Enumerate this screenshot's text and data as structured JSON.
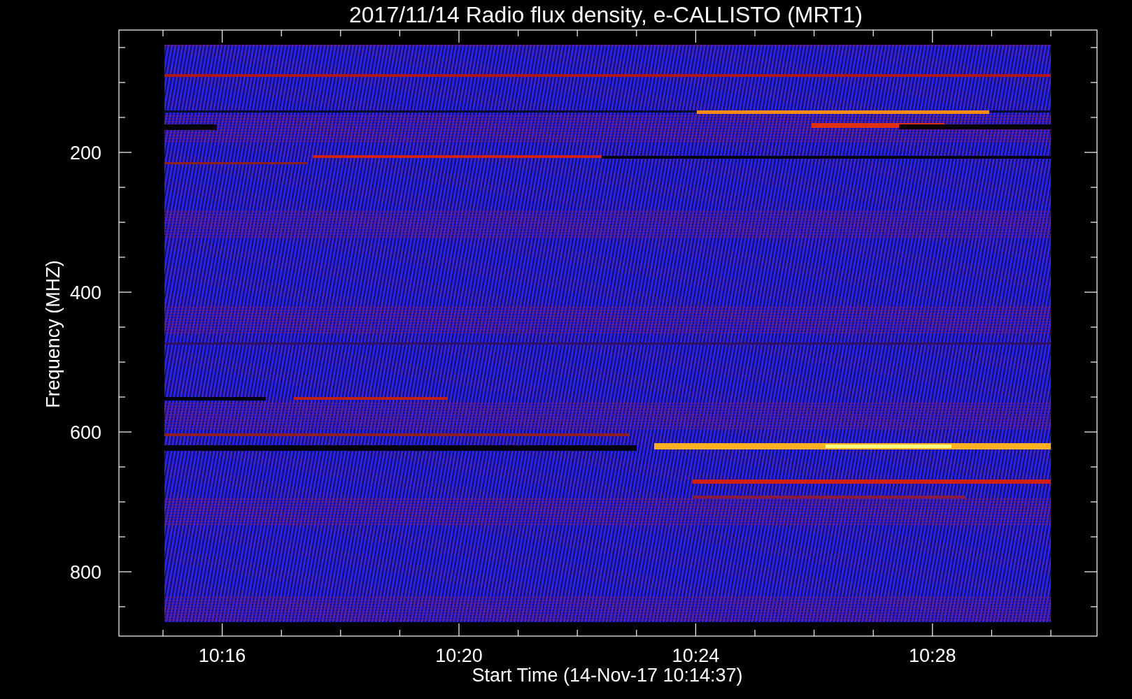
{
  "title": "2017/11/14  Radio flux density, e-CALLISTO (MRT1)",
  "y_axis": {
    "label": "Frequency (MHZ)",
    "ticks": [
      "200",
      "400",
      "600",
      "800"
    ]
  },
  "x_axis": {
    "label": "Start Time (14-Nov-17 10:14:37)",
    "ticks": [
      "10:16",
      "10:20",
      "10:24",
      "10:28"
    ]
  }
}
